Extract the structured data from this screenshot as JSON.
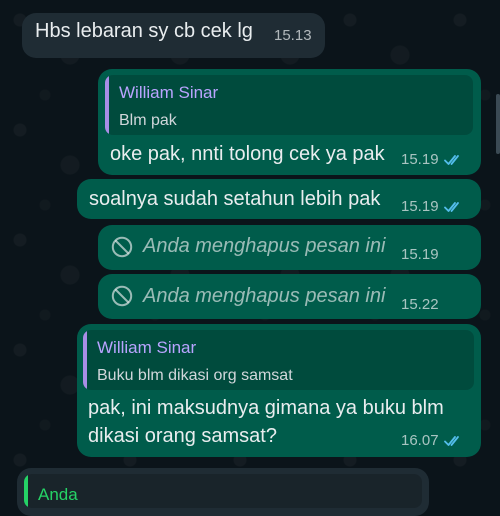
{
  "messages": [
    {
      "type": "incoming",
      "text": "Hbs lebaran sy cb cek lg",
      "time": "15.13"
    },
    {
      "type": "outgoing_reply",
      "quote_author": "William Sinar",
      "quote_text": "Blm pak",
      "text": "oke pak, nnti tolong cek ya pak",
      "time": "15.19"
    },
    {
      "type": "outgoing",
      "text": "soalnya sudah setahun lebih pak",
      "time": "15.19"
    },
    {
      "type": "deleted",
      "text": "Anda menghapus pesan ini",
      "time": "15.19"
    },
    {
      "type": "deleted",
      "text": "Anda menghapus pesan ini",
      "time": "15.22"
    },
    {
      "type": "outgoing_reply",
      "quote_author": "William Sinar",
      "quote_text": "Buku blm dikasi org samsat",
      "text_lines": [
        "pak, ini maksudnya gimana ya buku blm",
        "dikasi orang samsat?"
      ],
      "time": "16.07"
    },
    {
      "type": "incoming_partial_quote",
      "quote_author": "Anda"
    }
  ],
  "colors": {
    "background": "#0b141a",
    "incoming_bubble": "#1f2c34",
    "outgoing_bubble": "#005c4b",
    "read_receipt": "#53bdeb"
  },
  "icons": {
    "read_receipt": "double-check-icon",
    "deleted": "block-icon"
  }
}
